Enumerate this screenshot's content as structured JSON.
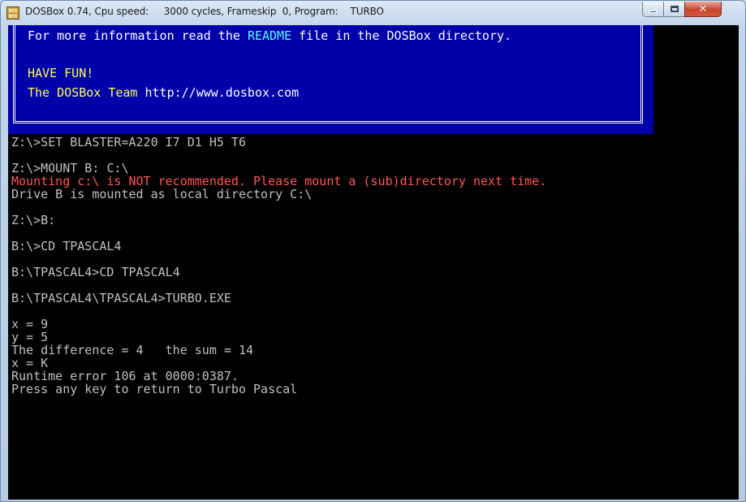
{
  "window": {
    "icon_text": "DOS BOX",
    "title": "DOSBox 0.74, Cpu speed:     3000 cycles, Frameskip  0, Program:    TURBO",
    "minimize_icon": "minimize-icon",
    "maximize_icon": "maximize-icon",
    "close_icon": "close-icon",
    "close_glyph": "✕"
  },
  "banner": {
    "line1_prefix": "For more information read the ",
    "line1_highlight": "README",
    "line1_suffix": " file in the DOSBox directory.",
    "line2": "HAVE FUN!",
    "line3_prefix": "The DOSBox Team ",
    "line3_url": "http://www.dosbox.com"
  },
  "console": {
    "lines": [
      {
        "text": "Z:\\>SET BLASTER=A220 I7 D1 H5 T6",
        "color": "#c0c0c0"
      },
      {
        "text": "",
        "color": "#c0c0c0"
      },
      {
        "text": "Z:\\>MOUNT B: C:\\",
        "color": "#c0c0c0"
      },
      {
        "text": "Mounting c:\\ is NOT recommended. Please mount a (sub)directory next time.",
        "color": "#ff5555"
      },
      {
        "text": "Drive B is mounted as local directory C:\\",
        "color": "#c0c0c0"
      },
      {
        "text": "",
        "color": "#c0c0c0"
      },
      {
        "text": "Z:\\>B:",
        "color": "#c0c0c0"
      },
      {
        "text": "",
        "color": "#c0c0c0"
      },
      {
        "text": "B:\\>CD TPASCAL4",
        "color": "#c0c0c0"
      },
      {
        "text": "",
        "color": "#c0c0c0"
      },
      {
        "text": "B:\\TPASCAL4>CD TPASCAL4",
        "color": "#c0c0c0"
      },
      {
        "text": "",
        "color": "#c0c0c0"
      },
      {
        "text": "B:\\TPASCAL4\\TPASCAL4>TURBO.EXE",
        "color": "#c0c0c0"
      },
      {
        "text": "",
        "color": "#c0c0c0"
      },
      {
        "text": "x = 9",
        "color": "#c0c0c0"
      },
      {
        "text": "y = 5",
        "color": "#c0c0c0"
      },
      {
        "text": "The difference = 4   the sum = 14",
        "color": "#c0c0c0"
      },
      {
        "text": "x = K",
        "color": "#c0c0c0"
      },
      {
        "text": "Runtime error 106 at 0000:0387.",
        "color": "#c0c0c0"
      },
      {
        "text": "Press any key to return to Turbo Pascal",
        "color": "#c0c0c0"
      }
    ]
  },
  "colors": {
    "banner_bg": "#0000aa",
    "console_fg": "#c0c0c0",
    "error_red": "#ff5555",
    "yellow": "#ffff55",
    "cyan": "#55ffff"
  }
}
